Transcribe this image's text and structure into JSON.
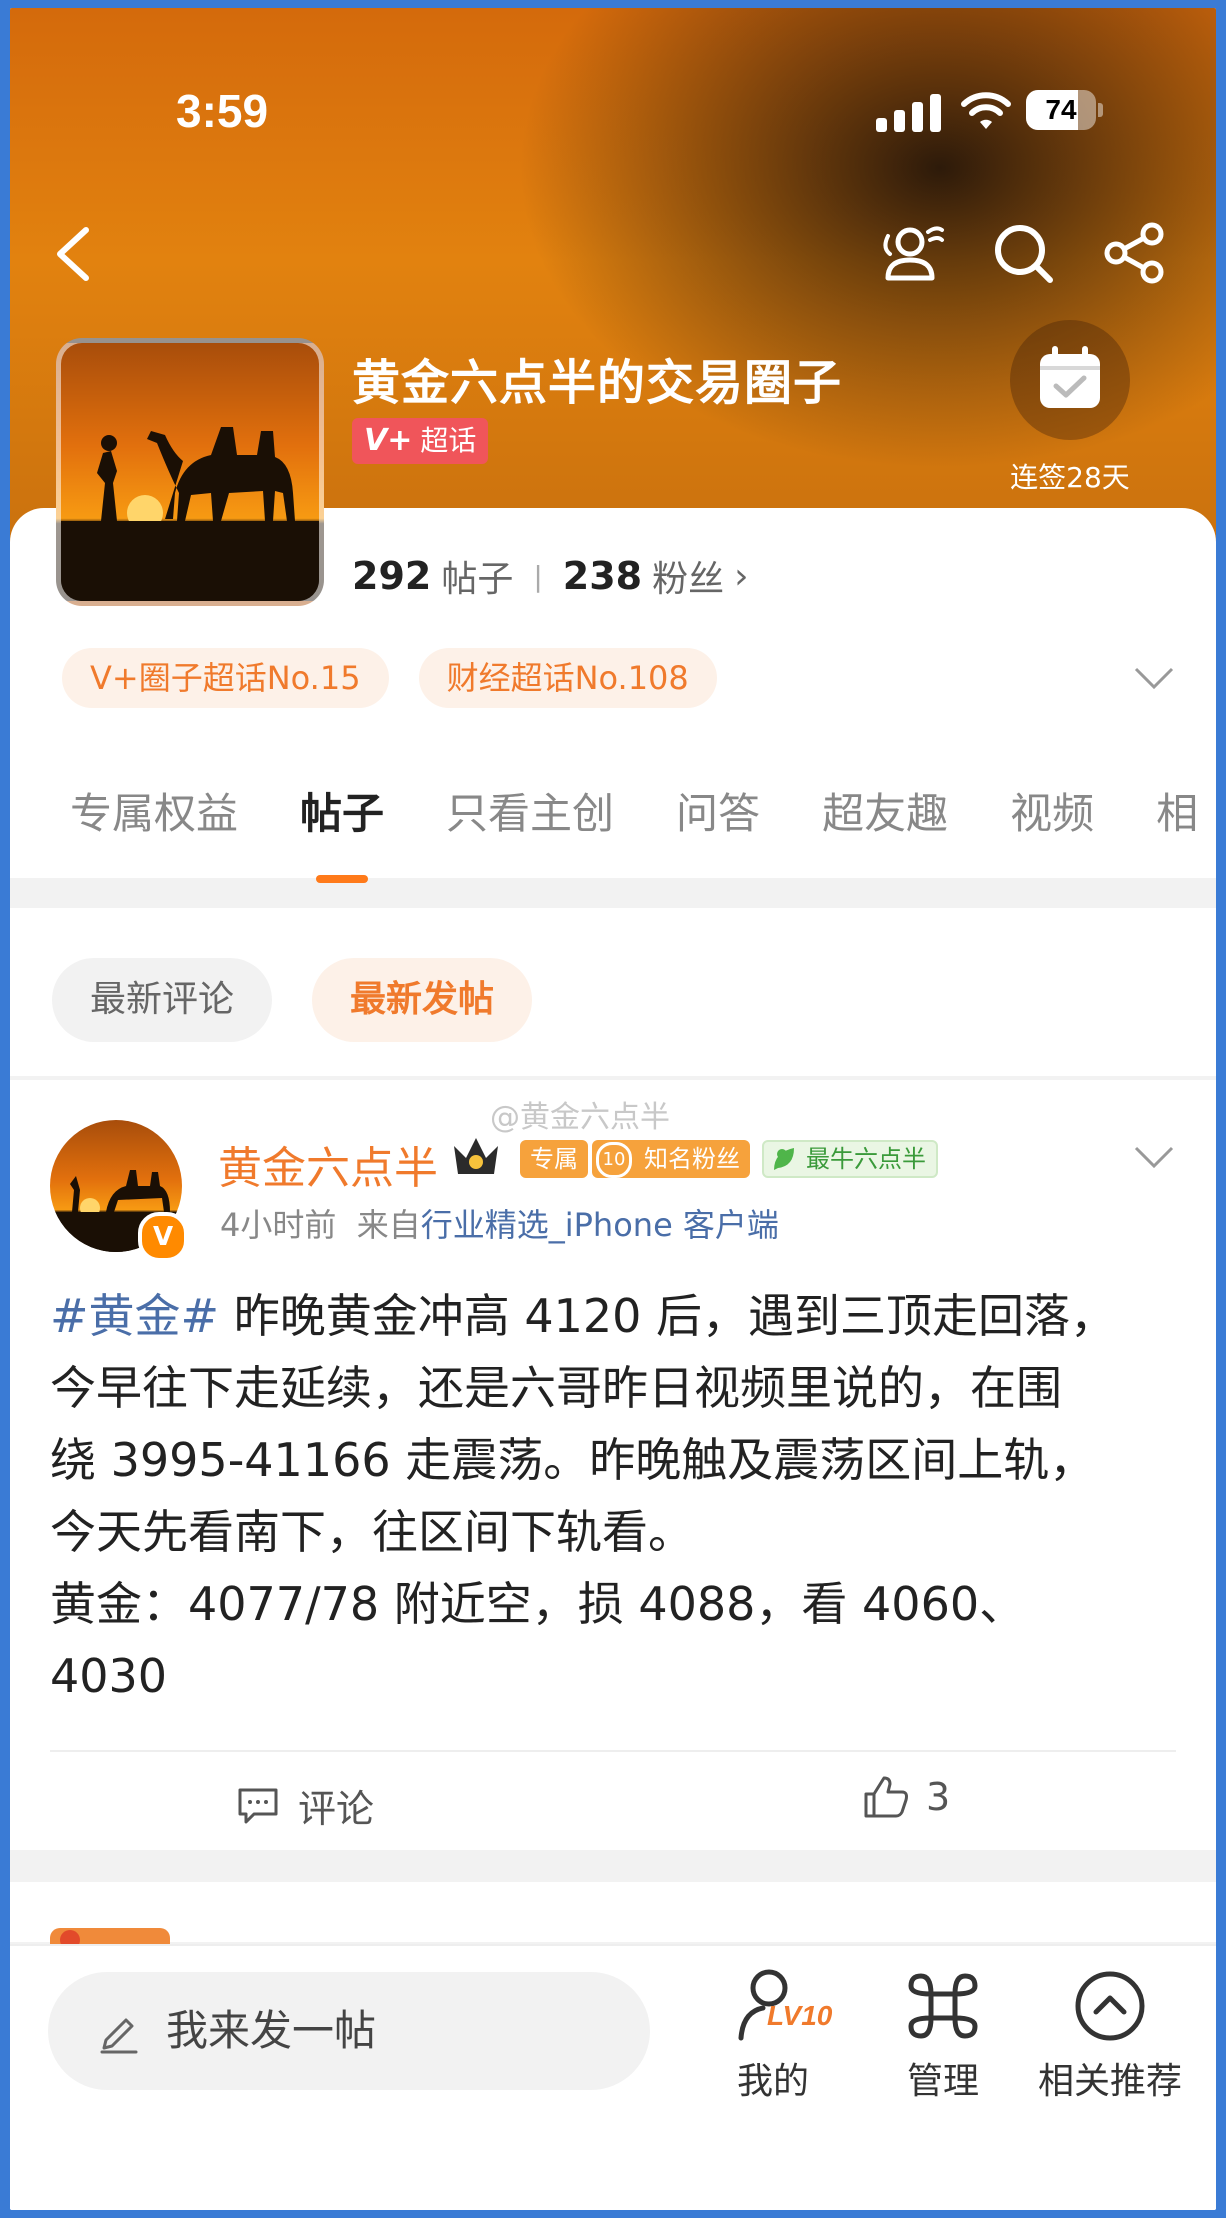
{
  "status_bar": {
    "time": "3:59",
    "battery": "74",
    "battery_level": 0.74
  },
  "header": {
    "title": "黄金六点半的交易圈子",
    "super_badge_v": "V+",
    "super_badge_label": "超话",
    "checkin_label": "连签28天",
    "posts_count": "292",
    "posts_label": "帖子",
    "fans_count": "238",
    "fans_label": "粉丝",
    "fans_chevron": "›",
    "tags": [
      "V+圈子超话No.15",
      "财经超话No.108"
    ],
    "icons": [
      "back-icon",
      "people-icon",
      "search-icon",
      "share-icon",
      "calendar-check-icon",
      "chevron-down-icon"
    ]
  },
  "tabs": [
    "专属权益",
    "帖子",
    "只看主创",
    "问答",
    "超友趣",
    "视频",
    "相"
  ],
  "active_tab": "帖子",
  "sort": {
    "latest_comments": "最新评论",
    "latest_posts": "最新发帖"
  },
  "post": {
    "author": "黄金六点半",
    "chip_exclusive": "专属",
    "chip_fans_level": "10",
    "chip_fans": "知名粉丝",
    "chip_best": "最牛六点半",
    "vbadge": "V",
    "watermark": "@黄金六点半",
    "time": "4小时前",
    "source_prefix": "来自",
    "source": "行业精选_iPhone 客户端",
    "hashtag": "#黄金#",
    "line1_rest": " 昨晚黄金冲高 4120 后，遇到三顶走回落，",
    "line2": "今早往下走延续，还是六哥昨日视频里说的，在围",
    "line3": "绕 3995-41166 走震荡。昨晚触及震荡区间上轨，",
    "line4": "今天先看南下，往区间下轨看。",
    "line5": "黄金：4077/78 附近空，损 4088，看 4060、",
    "line6": "4030",
    "comment_label": "评论",
    "likes": "3"
  },
  "bottom_bar": {
    "compose_placeholder": "我来发一帖",
    "mine_label": "我的",
    "mine_level": "LV10",
    "manage_label": "管理",
    "recommend_label": "相关推荐"
  },
  "colors": {
    "accent": "#f07a2c",
    "link": "#4a6ea8",
    "hero": "#d46a0c"
  }
}
